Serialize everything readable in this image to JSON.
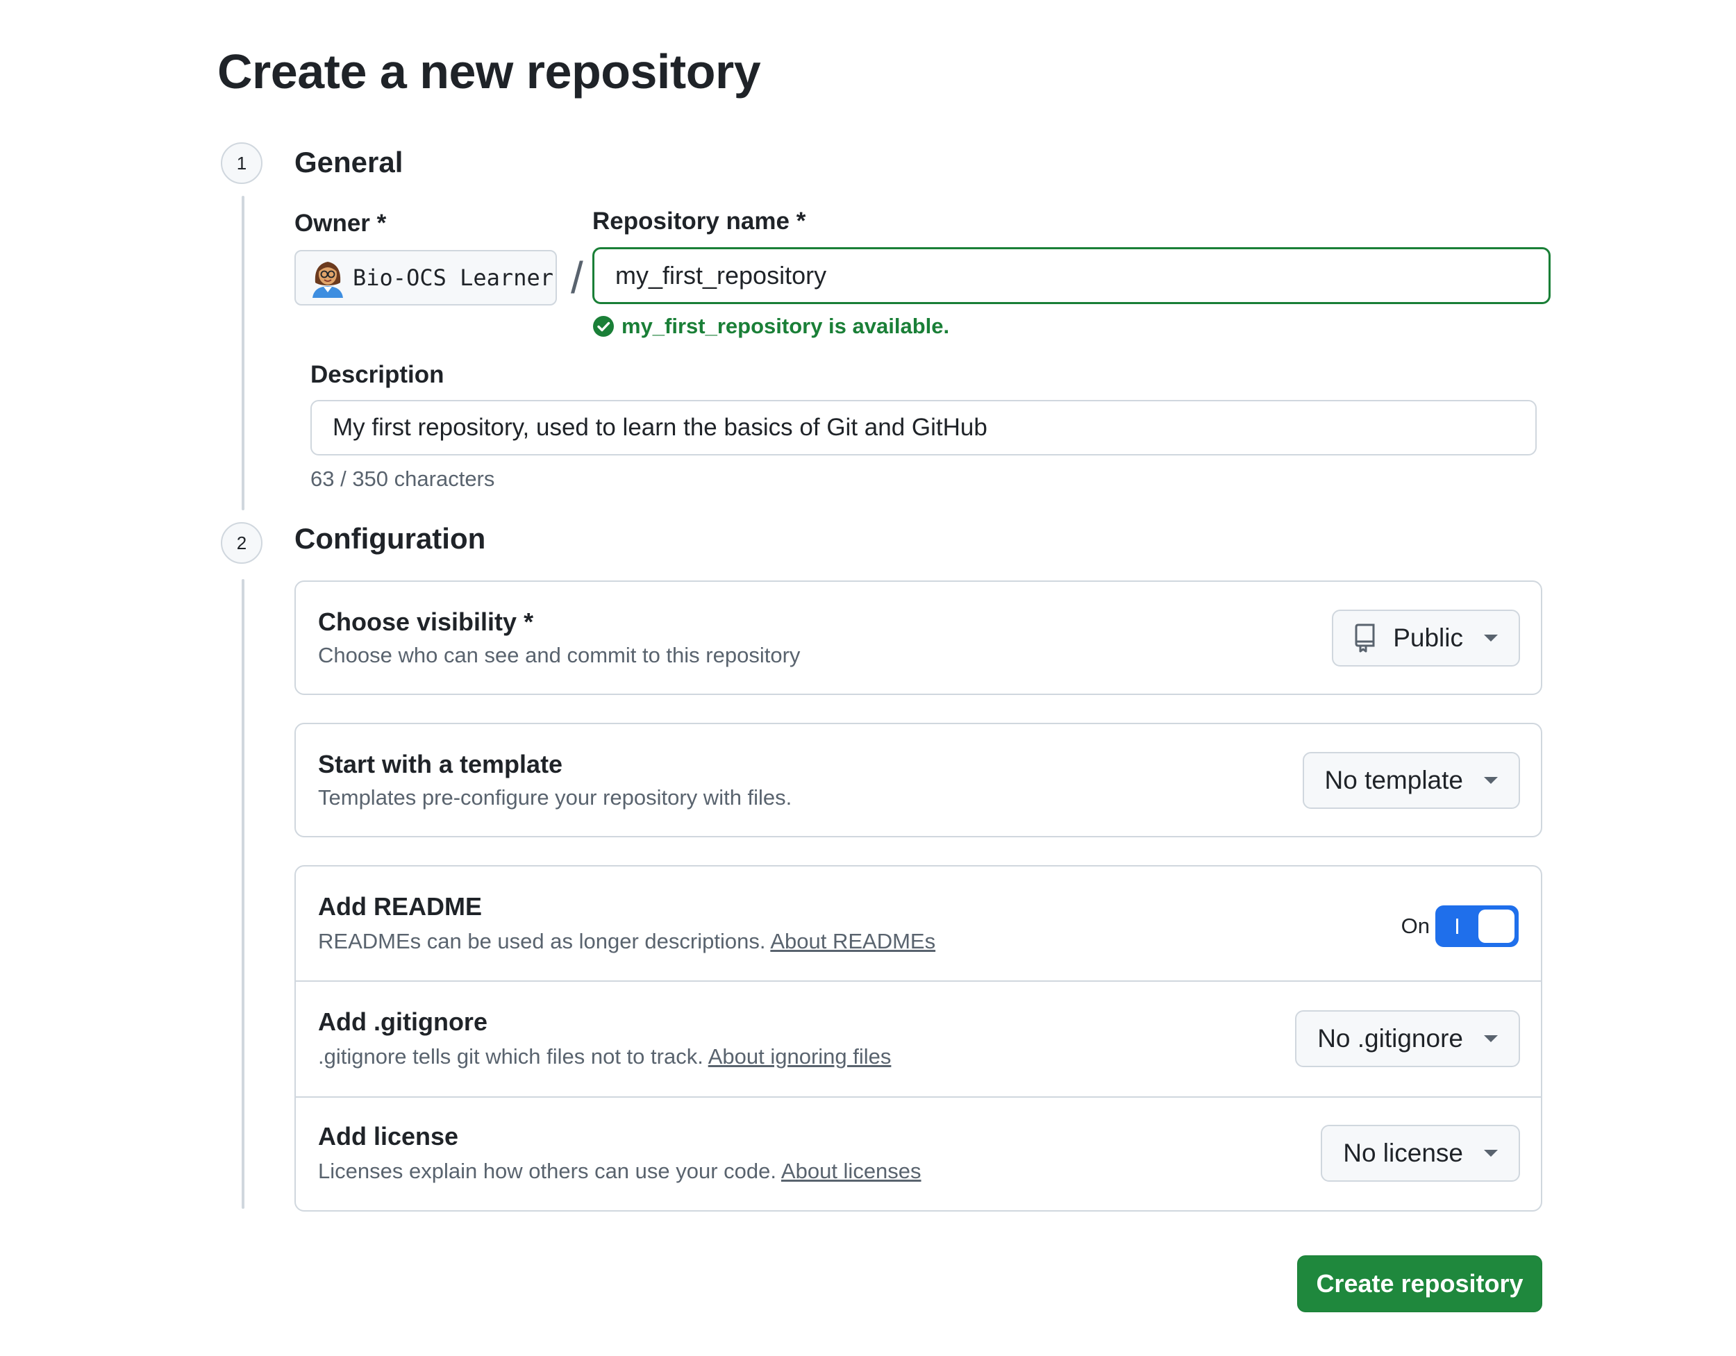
{
  "page": {
    "title": "Create a new repository"
  },
  "steps": [
    {
      "number": "1",
      "title": "General"
    },
    {
      "number": "2",
      "title": "Configuration"
    }
  ],
  "general": {
    "owner_label": "Owner *",
    "owner_value": "Bio-OCS Learner",
    "owner_avatar_icon": "avatar-person-icon",
    "separator": "/",
    "repo_name_label": "Repository name *",
    "repo_name_value": "my_first_repository",
    "availability_message": "my_first_repository is available.",
    "availability_icon": "check-circle-icon",
    "description_label": "Description",
    "description_value": "My first repository, used to learn the basics of Git and GitHub",
    "char_count": "63 / 350 characters"
  },
  "configuration": {
    "visibility": {
      "title": "Choose visibility *",
      "description": "Choose who can see and commit to this repository",
      "selected": "Public",
      "icon": "repo-icon"
    },
    "template": {
      "title": "Start with a template",
      "description": "Templates pre-configure your repository with files.",
      "selected": "No template"
    },
    "readme": {
      "title": "Add README",
      "description": "READMEs can be used as longer descriptions.",
      "link": "About READMEs",
      "toggle_label": "On",
      "enabled": true
    },
    "gitignore": {
      "title": "Add .gitignore",
      "description": ".gitignore tells git which files not to track.",
      "link": "About ignoring files",
      "selected": "No .gitignore"
    },
    "license": {
      "title": "Add license",
      "description": "Licenses explain how others can use your code.",
      "link": "About licenses",
      "selected": "No license"
    }
  },
  "actions": {
    "create_label": "Create repository"
  },
  "colors": {
    "accent_green": "#1f883d",
    "success_text": "#1a7f37",
    "toggle_blue": "#1f6feb",
    "border": "#d0d7de",
    "muted_text": "#59636e"
  }
}
